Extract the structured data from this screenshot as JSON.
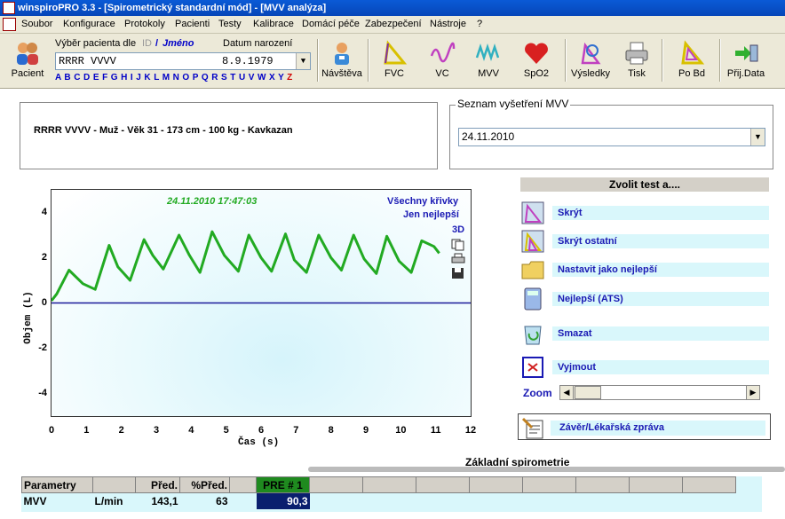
{
  "window": {
    "title": "winspiroPRO 3.3 - [Spirometrický standardní mód] - [MVV analýza]"
  },
  "menu": [
    "Soubor",
    "Konfigurace",
    "Protokoly",
    "Pacienti",
    "Testy",
    "Kalibrace",
    "Domácí péče",
    "Zabezpečení",
    "Nástroje",
    "?"
  ],
  "toolbar": {
    "patient_label": "Pacient",
    "select_label": "Výběr pacienta dle",
    "id_label": "ID",
    "slash": "/",
    "name_label": "Jméno",
    "dob_label": "Datum narození",
    "patient_name": "RRRR VVVV",
    "patient_dob": "8.9.1979",
    "alphabet": "A B C D E F G H I J K L M N O P Q R S T U V W X Y",
    "alphabet_last": "Z",
    "buttons": {
      "visit": "Návštěva",
      "fvc": "FVC",
      "vc": "VC",
      "mvv": "MVV",
      "spo2": "SpO2",
      "results": "Výsledky",
      "print": "Tisk",
      "pobd": "Po Bd",
      "receive": "Přij.Data"
    }
  },
  "patient_info": "RRRR VVVV - Muž - Věk 31 - 173 cm - 100 kg - Kavkazan",
  "exam_list": {
    "legend": "Seznam vyšetření MVV",
    "selected": "24.11.2010"
  },
  "chart_data": {
    "type": "line",
    "timestamp": "24.11.2010 17:47:03",
    "legend_all": "Všechny křivky",
    "legend_best": "Jen nejlepší",
    "mode_3d": "3D",
    "xlabel": "Čas (s)",
    "ylabel": "Objem (L)",
    "xlim": [
      0,
      12
    ],
    "ylim": [
      -5,
      5
    ],
    "xticks": [
      "0",
      "1",
      "2",
      "3",
      "4",
      "5",
      "6",
      "7",
      "8",
      "9",
      "10",
      "11",
      "12"
    ],
    "yticks": [
      "4",
      "2",
      "0",
      "-2",
      "-4"
    ],
    "x": [
      0,
      0.15,
      0.5,
      0.9,
      1.25,
      1.65,
      1.9,
      2.25,
      2.65,
      2.9,
      3.2,
      3.65,
      3.95,
      4.25,
      4.6,
      4.95,
      5.35,
      5.65,
      6.0,
      6.3,
      6.7,
      6.95,
      7.3,
      7.65,
      8.0,
      8.3,
      8.65,
      8.95,
      9.3,
      9.6,
      9.95,
      10.3,
      10.6,
      10.95,
      11.1
    ],
    "y": [
      0.1,
      0.4,
      1.45,
      0.85,
      0.6,
      2.55,
      1.6,
      1.0,
      2.8,
      2.1,
      1.5,
      3.0,
      2.1,
      1.35,
      3.15,
      2.1,
      1.4,
      3.0,
      2.0,
      1.4,
      3.05,
      1.9,
      1.35,
      3.0,
      2.0,
      1.45,
      3.0,
      1.95,
      1.3,
      2.95,
      1.85,
      1.35,
      2.75,
      2.5,
      2.2
    ]
  },
  "side_panel": {
    "header": "Zvolit test a....",
    "actions": [
      "Skrýt",
      "Skrýt ostatní",
      "Nastavit jako nejlepší",
      "Nejlepší (ATS)",
      "Smazat",
      "Vyjmout"
    ],
    "zoom_label": "Zoom",
    "report": "Závěr/Lékařská zpráva"
  },
  "results": {
    "title": "Základní spirometrie",
    "headers": [
      "Parametry",
      "",
      "Před.",
      "%Před.",
      "",
      "PRE # 1"
    ],
    "row": {
      "param": "MVV",
      "unit": "L/min",
      "pred": "143,1",
      "pct": "63",
      "pre1": "90,3"
    }
  }
}
